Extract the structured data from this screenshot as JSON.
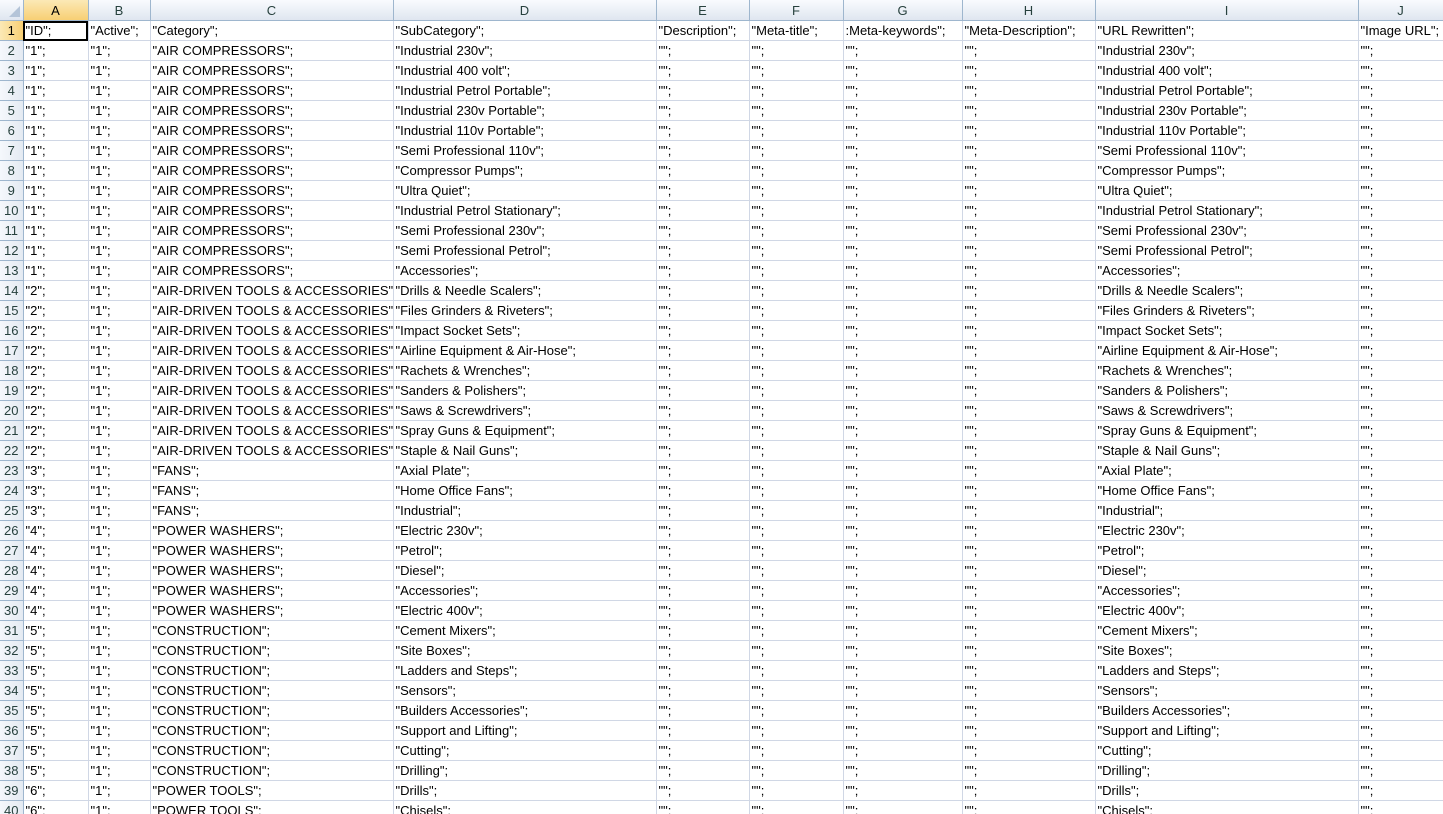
{
  "column_headers": [
    "A",
    "B",
    "C",
    "D",
    "E",
    "F",
    "G",
    "H",
    "I",
    "J"
  ],
  "active_cell": "A1",
  "rows": [
    {
      "n": "1",
      "cells": [
        "\"ID\";",
        "\"Active\";",
        "\"Category\";",
        "\"SubCategory\";",
        "\"Description\";",
        "\"Meta-title\";",
        ":Meta-keywords\";",
        "\"Meta-Description\";",
        "\"URL Rewritten\";",
        "\"Image URL\";"
      ]
    },
    {
      "n": "2",
      "cells": [
        "\"1\";",
        "\"1\";",
        "\"AIR COMPRESSORS\";",
        "\"Industrial 230v\";",
        "\"\";",
        "\"\";",
        "\"\";",
        "\"\";",
        "\"Industrial 230v\";",
        "\"\";"
      ]
    },
    {
      "n": "3",
      "cells": [
        "\"1\";",
        "\"1\";",
        "\"AIR COMPRESSORS\";",
        "\"Industrial 400 volt\";",
        "\"\";",
        "\"\";",
        "\"\";",
        "\"\";",
        "\"Industrial 400 volt\";",
        "\"\";"
      ]
    },
    {
      "n": "4",
      "cells": [
        "\"1\";",
        "\"1\";",
        "\"AIR COMPRESSORS\";",
        "\"Industrial Petrol Portable\";",
        "\"\";",
        "\"\";",
        "\"\";",
        "\"\";",
        "\"Industrial Petrol Portable\";",
        "\"\";"
      ]
    },
    {
      "n": "5",
      "cells": [
        "\"1\";",
        "\"1\";",
        "\"AIR COMPRESSORS\";",
        "\"Industrial 230v Portable\";",
        "\"\";",
        "\"\";",
        "\"\";",
        "\"\";",
        "\"Industrial 230v Portable\";",
        "\"\";"
      ]
    },
    {
      "n": "6",
      "cells": [
        "\"1\";",
        "\"1\";",
        "\"AIR COMPRESSORS\";",
        "\"Industrial 110v Portable\";",
        "\"\";",
        "\"\";",
        "\"\";",
        "\"\";",
        "\"Industrial 110v Portable\";",
        "\"\";"
      ]
    },
    {
      "n": "7",
      "cells": [
        "\"1\";",
        "\"1\";",
        "\"AIR COMPRESSORS\";",
        "\"Semi Professional 110v\";",
        "\"\";",
        "\"\";",
        "\"\";",
        "\"\";",
        "\"Semi Professional 110v\";",
        "\"\";"
      ]
    },
    {
      "n": "8",
      "cells": [
        "\"1\";",
        "\"1\";",
        "\"AIR COMPRESSORS\";",
        "\"Compressor Pumps\";",
        "\"\";",
        "\"\";",
        "\"\";",
        "\"\";",
        "\"Compressor Pumps\";",
        "\"\";"
      ]
    },
    {
      "n": "9",
      "cells": [
        "\"1\";",
        "\"1\";",
        "\"AIR COMPRESSORS\";",
        "\"Ultra Quiet\";",
        "\"\";",
        "\"\";",
        "\"\";",
        "\"\";",
        "\"Ultra Quiet\";",
        "\"\";"
      ]
    },
    {
      "n": "10",
      "cells": [
        "\"1\";",
        "\"1\";",
        "\"AIR COMPRESSORS\";",
        "\"Industrial Petrol Stationary\";",
        "\"\";",
        "\"\";",
        "\"\";",
        "\"\";",
        "\"Industrial Petrol Stationary\";",
        "\"\";"
      ]
    },
    {
      "n": "11",
      "cells": [
        "\"1\";",
        "\"1\";",
        "\"AIR COMPRESSORS\";",
        "\"Semi Professional 230v\";",
        "\"\";",
        "\"\";",
        "\"\";",
        "\"\";",
        "\"Semi Professional 230v\";",
        "\"\";"
      ]
    },
    {
      "n": "12",
      "cells": [
        "\"1\";",
        "\"1\";",
        "\"AIR COMPRESSORS\";",
        "\"Semi Professional Petrol\";",
        "\"\";",
        "\"\";",
        "\"\";",
        "\"\";",
        "\"Semi Professional Petrol\";",
        "\"\";"
      ]
    },
    {
      "n": "13",
      "cells": [
        "\"1\";",
        "\"1\";",
        "\"AIR COMPRESSORS\";",
        "\"Accessories\";",
        "\"\";",
        "\"\";",
        "\"\";",
        "\"\";",
        "\"Accessories\";",
        "\"\";"
      ]
    },
    {
      "n": "14",
      "cells": [
        "\"2\";",
        "\"1\";",
        "\"AIR-DRIVEN TOOLS & ACCESSORIES\";",
        "\"Drills & Needle Scalers\";",
        "\"\";",
        "\"\";",
        "\"\";",
        "\"\";",
        "\"Drills & Needle Scalers\";",
        "\"\";"
      ]
    },
    {
      "n": "15",
      "cells": [
        "\"2\";",
        "\"1\";",
        "\"AIR-DRIVEN TOOLS & ACCESSORIES\";",
        "\"Files Grinders & Riveters\";",
        "\"\";",
        "\"\";",
        "\"\";",
        "\"\";",
        "\"Files Grinders & Riveters\";",
        "\"\";"
      ]
    },
    {
      "n": "16",
      "cells": [
        "\"2\";",
        "\"1\";",
        "\"AIR-DRIVEN TOOLS & ACCESSORIES\";",
        "\"Impact Socket Sets\";",
        "\"\";",
        "\"\";",
        "\"\";",
        "\"\";",
        "\"Impact Socket Sets\";",
        "\"\";"
      ]
    },
    {
      "n": "17",
      "cells": [
        "\"2\";",
        "\"1\";",
        "\"AIR-DRIVEN TOOLS & ACCESSORIES\";",
        "\"Airline Equipment & Air-Hose\";",
        "\"\";",
        "\"\";",
        "\"\";",
        "\"\";",
        "\"Airline Equipment & Air-Hose\";",
        "\"\";"
      ]
    },
    {
      "n": "18",
      "cells": [
        "\"2\";",
        "\"1\";",
        "\"AIR-DRIVEN TOOLS & ACCESSORIES\";",
        "\"Rachets & Wrenches\";",
        "\"\";",
        "\"\";",
        "\"\";",
        "\"\";",
        "\"Rachets & Wrenches\";",
        "\"\";"
      ]
    },
    {
      "n": "19",
      "cells": [
        "\"2\";",
        "\"1\";",
        "\"AIR-DRIVEN TOOLS & ACCESSORIES\";",
        "\"Sanders & Polishers\";",
        "\"\";",
        "\"\";",
        "\"\";",
        "\"\";",
        "\"Sanders & Polishers\";",
        "\"\";"
      ]
    },
    {
      "n": "20",
      "cells": [
        "\"2\";",
        "\"1\";",
        "\"AIR-DRIVEN TOOLS & ACCESSORIES\";",
        "\"Saws & Screwdrivers\";",
        "\"\";",
        "\"\";",
        "\"\";",
        "\"\";",
        "\"Saws & Screwdrivers\";",
        "\"\";"
      ]
    },
    {
      "n": "21",
      "cells": [
        "\"2\";",
        "\"1\";",
        "\"AIR-DRIVEN TOOLS & ACCESSORIES\";",
        "\"Spray Guns & Equipment\";",
        "\"\";",
        "\"\";",
        "\"\";",
        "\"\";",
        "\"Spray Guns & Equipment\";",
        "\"\";"
      ]
    },
    {
      "n": "22",
      "cells": [
        "\"2\";",
        "\"1\";",
        "\"AIR-DRIVEN TOOLS & ACCESSORIES\";",
        "\"Staple & Nail Guns\";",
        "\"\";",
        "\"\";",
        "\"\";",
        "\"\";",
        "\"Staple & Nail Guns\";",
        "\"\";"
      ]
    },
    {
      "n": "23",
      "cells": [
        "\"3\";",
        "\"1\";",
        "\"FANS\";",
        "\"Axial Plate\";",
        "\"\";",
        "\"\";",
        "\"\";",
        "\"\";",
        "\"Axial Plate\";",
        "\"\";"
      ]
    },
    {
      "n": "24",
      "cells": [
        "\"3\";",
        "\"1\";",
        "\"FANS\";",
        "\"Home Office Fans\";",
        "\"\";",
        "\"\";",
        "\"\";",
        "\"\";",
        "\"Home Office Fans\";",
        "\"\";"
      ]
    },
    {
      "n": "25",
      "cells": [
        "\"3\";",
        "\"1\";",
        "\"FANS\";",
        "\"Industrial\";",
        "\"\";",
        "\"\";",
        "\"\";",
        "\"\";",
        "\"Industrial\";",
        "\"\";"
      ]
    },
    {
      "n": "26",
      "cells": [
        "\"4\";",
        "\"1\";",
        "\"POWER WASHERS\";",
        "\"Electric 230v\";",
        "\"\";",
        "\"\";",
        "\"\";",
        "\"\";",
        "\"Electric 230v\";",
        "\"\";"
      ]
    },
    {
      "n": "27",
      "cells": [
        "\"4\";",
        "\"1\";",
        "\"POWER WASHERS\";",
        "\"Petrol\";",
        "\"\";",
        "\"\";",
        "\"\";",
        "\"\";",
        "\"Petrol\";",
        "\"\";"
      ]
    },
    {
      "n": "28",
      "cells": [
        "\"4\";",
        "\"1\";",
        "\"POWER WASHERS\";",
        "\"Diesel\";",
        "\"\";",
        "\"\";",
        "\"\";",
        "\"\";",
        "\"Diesel\";",
        "\"\";"
      ]
    },
    {
      "n": "29",
      "cells": [
        "\"4\";",
        "\"1\";",
        "\"POWER WASHERS\";",
        "\"Accessories\";",
        "\"\";",
        "\"\";",
        "\"\";",
        "\"\";",
        "\"Accessories\";",
        "\"\";"
      ]
    },
    {
      "n": "30",
      "cells": [
        "\"4\";",
        "\"1\";",
        "\"POWER WASHERS\";",
        "\"Electric 400v\";",
        "\"\";",
        "\"\";",
        "\"\";",
        "\"\";",
        "\"Electric 400v\";",
        "\"\";"
      ]
    },
    {
      "n": "31",
      "cells": [
        "\"5\";",
        "\"1\";",
        "\"CONSTRUCTION\";",
        "\"Cement Mixers\";",
        "\"\";",
        "\"\";",
        "\"\";",
        "\"\";",
        "\"Cement Mixers\";",
        "\"\";"
      ]
    },
    {
      "n": "32",
      "cells": [
        "\"5\";",
        "\"1\";",
        "\"CONSTRUCTION\";",
        "\"Site Boxes\";",
        "\"\";",
        "\"\";",
        "\"\";",
        "\"\";",
        "\"Site Boxes\";",
        "\"\";"
      ]
    },
    {
      "n": "33",
      "cells": [
        "\"5\";",
        "\"1\";",
        "\"CONSTRUCTION\";",
        "\"Ladders and Steps\";",
        "\"\";",
        "\"\";",
        "\"\";",
        "\"\";",
        "\"Ladders and Steps\";",
        "\"\";"
      ]
    },
    {
      "n": "34",
      "cells": [
        "\"5\";",
        "\"1\";",
        "\"CONSTRUCTION\";",
        "\"Sensors\";",
        "\"\";",
        "\"\";",
        "\"\";",
        "\"\";",
        "\"Sensors\";",
        "\"\";"
      ]
    },
    {
      "n": "35",
      "cells": [
        "\"5\";",
        "\"1\";",
        "\"CONSTRUCTION\";",
        "\"Builders Accessories\";",
        "\"\";",
        "\"\";",
        "\"\";",
        "\"\";",
        "\"Builders Accessories\";",
        "\"\";"
      ]
    },
    {
      "n": "36",
      "cells": [
        "\"5\";",
        "\"1\";",
        "\"CONSTRUCTION\";",
        "\"Support and Lifting\";",
        "\"\";",
        "\"\";",
        "\"\";",
        "\"\";",
        "\"Support and Lifting\";",
        "\"\";"
      ]
    },
    {
      "n": "37",
      "cells": [
        "\"5\";",
        "\"1\";",
        "\"CONSTRUCTION\";",
        "\"Cutting\";",
        "\"\";",
        "\"\";",
        "\"\";",
        "\"\";",
        "\"Cutting\";",
        "\"\";"
      ]
    },
    {
      "n": "38",
      "cells": [
        "\"5\";",
        "\"1\";",
        "\"CONSTRUCTION\";",
        "\"Drilling\";",
        "\"\";",
        "\"\";",
        "\"\";",
        "\"\";",
        "\"Drilling\";",
        "\"\";"
      ]
    },
    {
      "n": "39",
      "cells": [
        "\"6\";",
        "\"1\";",
        "\"POWER TOOLS\";",
        "\"Drills\";",
        "\"\";",
        "\"\";",
        "\"\";",
        "\"\";",
        "\"Drills\";",
        "\"\";"
      ]
    },
    {
      "n": "40",
      "cells": [
        "\"6\";",
        "\"1\";",
        "\"POWER TOOLS\";",
        "\"Chisels\";",
        "\"\";",
        "\"\";",
        "\"\";",
        "\"\";",
        "\"Chisels\";",
        "\"\";"
      ]
    }
  ]
}
